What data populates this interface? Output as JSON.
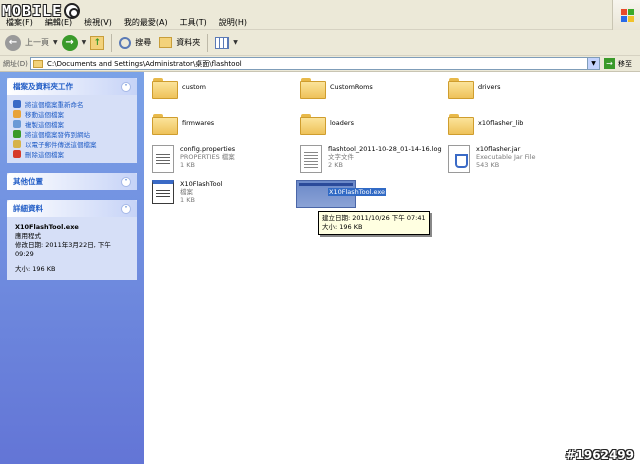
{
  "logo_text": "MOBILE",
  "menu": [
    "檔案(F)",
    "編輯(E)",
    "檢視(V)",
    "我的最愛(A)",
    "工具(T)",
    "說明(H)"
  ],
  "toolbar": {
    "back_label": "上一頁",
    "search_label": "搜尋",
    "folders_label": "資料夾"
  },
  "address": {
    "label": "網址(D)",
    "path": "C:\\Documents and Settings\\Administrator\\桌面\\flashtool",
    "go_label": "移至"
  },
  "left_panel": {
    "tasks_header": "檔案及資料夾工作",
    "tasks": [
      {
        "label": "將這個檔案重新命名",
        "color": "#3a6ac6"
      },
      {
        "label": "移動這個檔案",
        "color": "#e8a33a"
      },
      {
        "label": "複製這個檔案",
        "color": "#6a9ad6"
      },
      {
        "label": "將這個檔案發佈到網站",
        "color": "#3a9a2a"
      },
      {
        "label": "以電子郵件傳送這個檔案",
        "color": "#d6b34a"
      },
      {
        "label": "刪除這個檔案",
        "color": "#d63a2a"
      }
    ],
    "other_header": "其他位置",
    "details_header": "詳細資料",
    "details": {
      "filename": "X10FlashTool.exe",
      "type": "應用程式",
      "modified_line1": "修改日期: 2011年3月22日, 下午",
      "modified_line2": "09:29",
      "size": "大小: 196 KB"
    }
  },
  "files": [
    {
      "name": "custom",
      "kind": "folder"
    },
    {
      "name": "CustomRoms",
      "kind": "folder"
    },
    {
      "name": "drivers",
      "kind": "folder"
    },
    {
      "name": "firmwares",
      "kind": "folder"
    },
    {
      "name": "loaders",
      "kind": "folder"
    },
    {
      "name": "x10flasher_lib",
      "kind": "folder"
    },
    {
      "name": "config.properties",
      "kind": "cfg",
      "sub1": "PROPERTIES 檔案",
      "sub2": "1 KB"
    },
    {
      "name": "flashtool_2011-10-28_01-14-16.log",
      "kind": "log",
      "sub1": "文字文件",
      "sub2": "2 KB"
    },
    {
      "name": "x10flasher.jar",
      "kind": "jar",
      "sub1": "Executable Jar File",
      "sub2": "543 KB"
    },
    {
      "name": "X10FlashTool",
      "kind": "win",
      "sub1": "檔案",
      "sub2": "1 KB"
    },
    {
      "name": "X10FlashTool.exe",
      "kind": "exe"
    }
  ],
  "tooltip": {
    "line1": "建立日期: 2011/10/26 下午 07:41",
    "line2": "大小: 196 KB"
  },
  "watermark": "#1962499"
}
